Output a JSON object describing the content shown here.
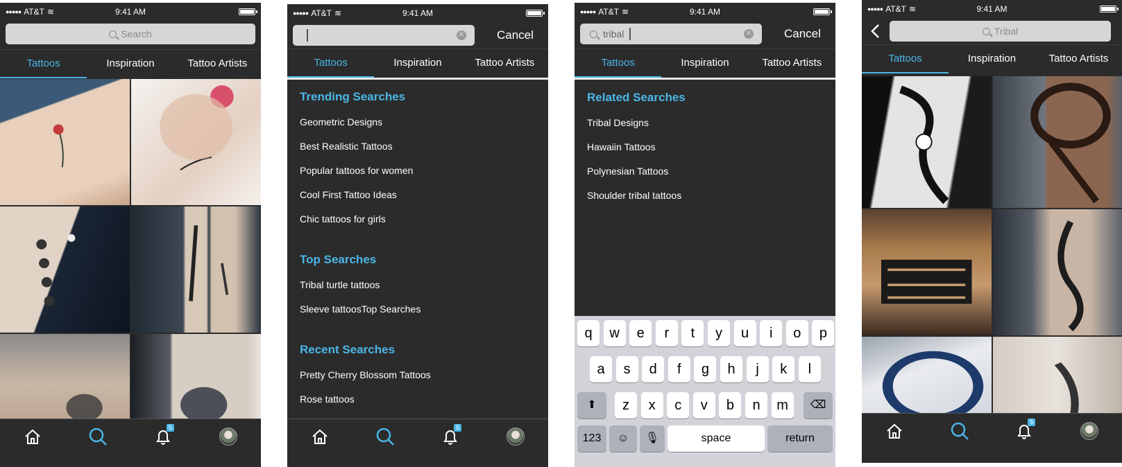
{
  "status": {
    "carrier": "AT&T",
    "time": "9:41 AM"
  },
  "tabs": {
    "tattoos": "Tattoos",
    "inspiration": "Inspiration",
    "artists": "Tattoo Artists"
  },
  "accent_color": "#4bb6e8",
  "screen1": {
    "search_placeholder": "Search"
  },
  "screen2": {
    "cancel": "Cancel",
    "trending_title": "Trending Searches",
    "trending": [
      "Geometric Designs",
      "Best Realistic Tattoos",
      "Popular tattoos for women",
      "Cool First Tattoo Ideas",
      "Chic tattoos for girls"
    ],
    "top_title": "Top Searches",
    "top": [
      "Tribal turtle tattoos",
      "Sleeve tattoosTop Searches"
    ],
    "recent_title": "Recent Searches",
    "recent": [
      "Pretty Cherry Blossom Tattoos",
      "Rose tattoos"
    ]
  },
  "screen3": {
    "query": "tribal",
    "cancel": "Cancel",
    "related_title": "Related Searches",
    "related": [
      "Tribal Designs",
      "Hawaiin Tattoos",
      "Polynesian Tattoos",
      "Shoulder tribal tattoos"
    ],
    "keys_row1": [
      "q",
      "w",
      "e",
      "r",
      "t",
      "y",
      "u",
      "i",
      "o",
      "p"
    ],
    "keys_row2": [
      "a",
      "s",
      "d",
      "f",
      "g",
      "h",
      "j",
      "k",
      "l"
    ],
    "keys_row3": [
      "z",
      "x",
      "c",
      "v",
      "b",
      "n",
      "m"
    ],
    "key_123": "123",
    "key_space": "space",
    "key_return": "return"
  },
  "screen4": {
    "query": "Tribal"
  },
  "notification_count": "5",
  "tabbar_icons": [
    "home-icon",
    "search-icon",
    "bell-icon",
    "avatar"
  ]
}
